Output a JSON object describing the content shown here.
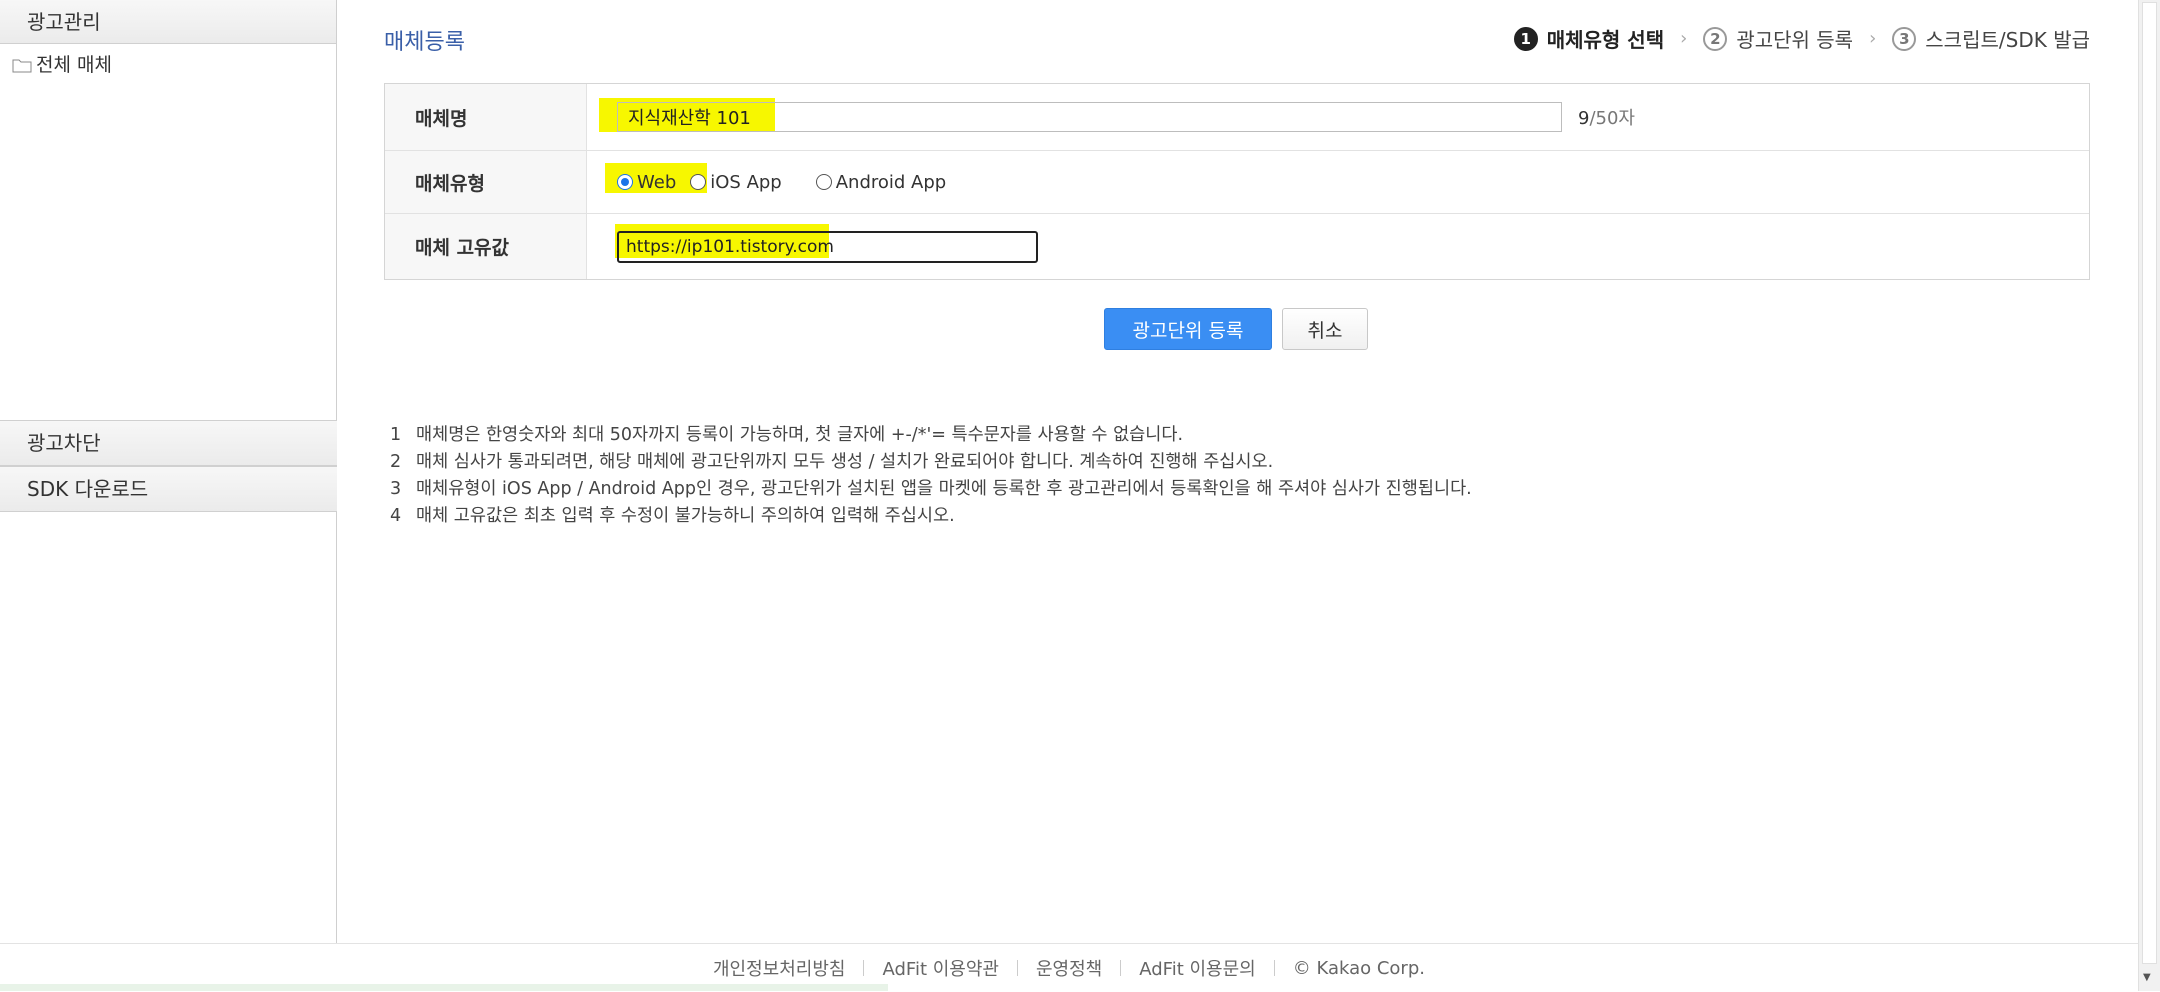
{
  "sidebar": {
    "header": "광고관리",
    "tree_item": "전체 매체",
    "menu": [
      "광고차단",
      "SDK 다운로드"
    ]
  },
  "main": {
    "title": "매체등록",
    "steps": [
      {
        "num": "1",
        "label": "매체유형 선택",
        "active": true
      },
      {
        "num": "2",
        "label": "광고단위 등록",
        "active": false
      },
      {
        "num": "3",
        "label": "스크립트/SDK 발급",
        "active": false
      }
    ],
    "form": {
      "name": {
        "label": "매체명",
        "value": "지식재산학 101",
        "count_current": "9",
        "count_total": "/50자"
      },
      "type": {
        "label": "매체유형",
        "options": [
          "Web",
          "iOS App",
          "Android App"
        ],
        "selected": "Web"
      },
      "uid": {
        "label": "매체 고유값",
        "value": "https://ip101.tistory.com"
      }
    },
    "buttons": {
      "register": "광고단위 등록",
      "cancel": "취소"
    },
    "notes": [
      {
        "num": "1",
        "text": "매체명은 한영숫자와 최대 50자까지 등록이 가능하며, 첫 글자에 +-/*'= 특수문자를 사용할 수 없습니다."
      },
      {
        "num": "2",
        "text": "매체 심사가 통과되려면, 해당 매체에 광고단위까지 모두 생성 / 설치가 완료되어야 합니다. 계속하여 진행해 주십시오."
      },
      {
        "num": "3",
        "text": "매체유형이 iOS App / Android App인 경우, 광고단위가 설치된 앱을 마켓에 등록한 후 광고관리에서 등록확인을 해 주셔야 심사가 진행됩니다."
      },
      {
        "num": "4",
        "text": "매체 고유값은 최초 입력 후 수정이 불가능하니 주의하여 입력해 주십시오."
      }
    ]
  },
  "footer": {
    "links": [
      "개인정보처리방침",
      "AdFit 이용약관",
      "운영정책",
      "AdFit 이용문의"
    ],
    "copyright": "© Kakao Corp."
  },
  "colors": {
    "accent": "#3a8ef3",
    "title": "#3a5fa8",
    "highlight": "#f7f700",
    "radio": "#1a73e8"
  }
}
